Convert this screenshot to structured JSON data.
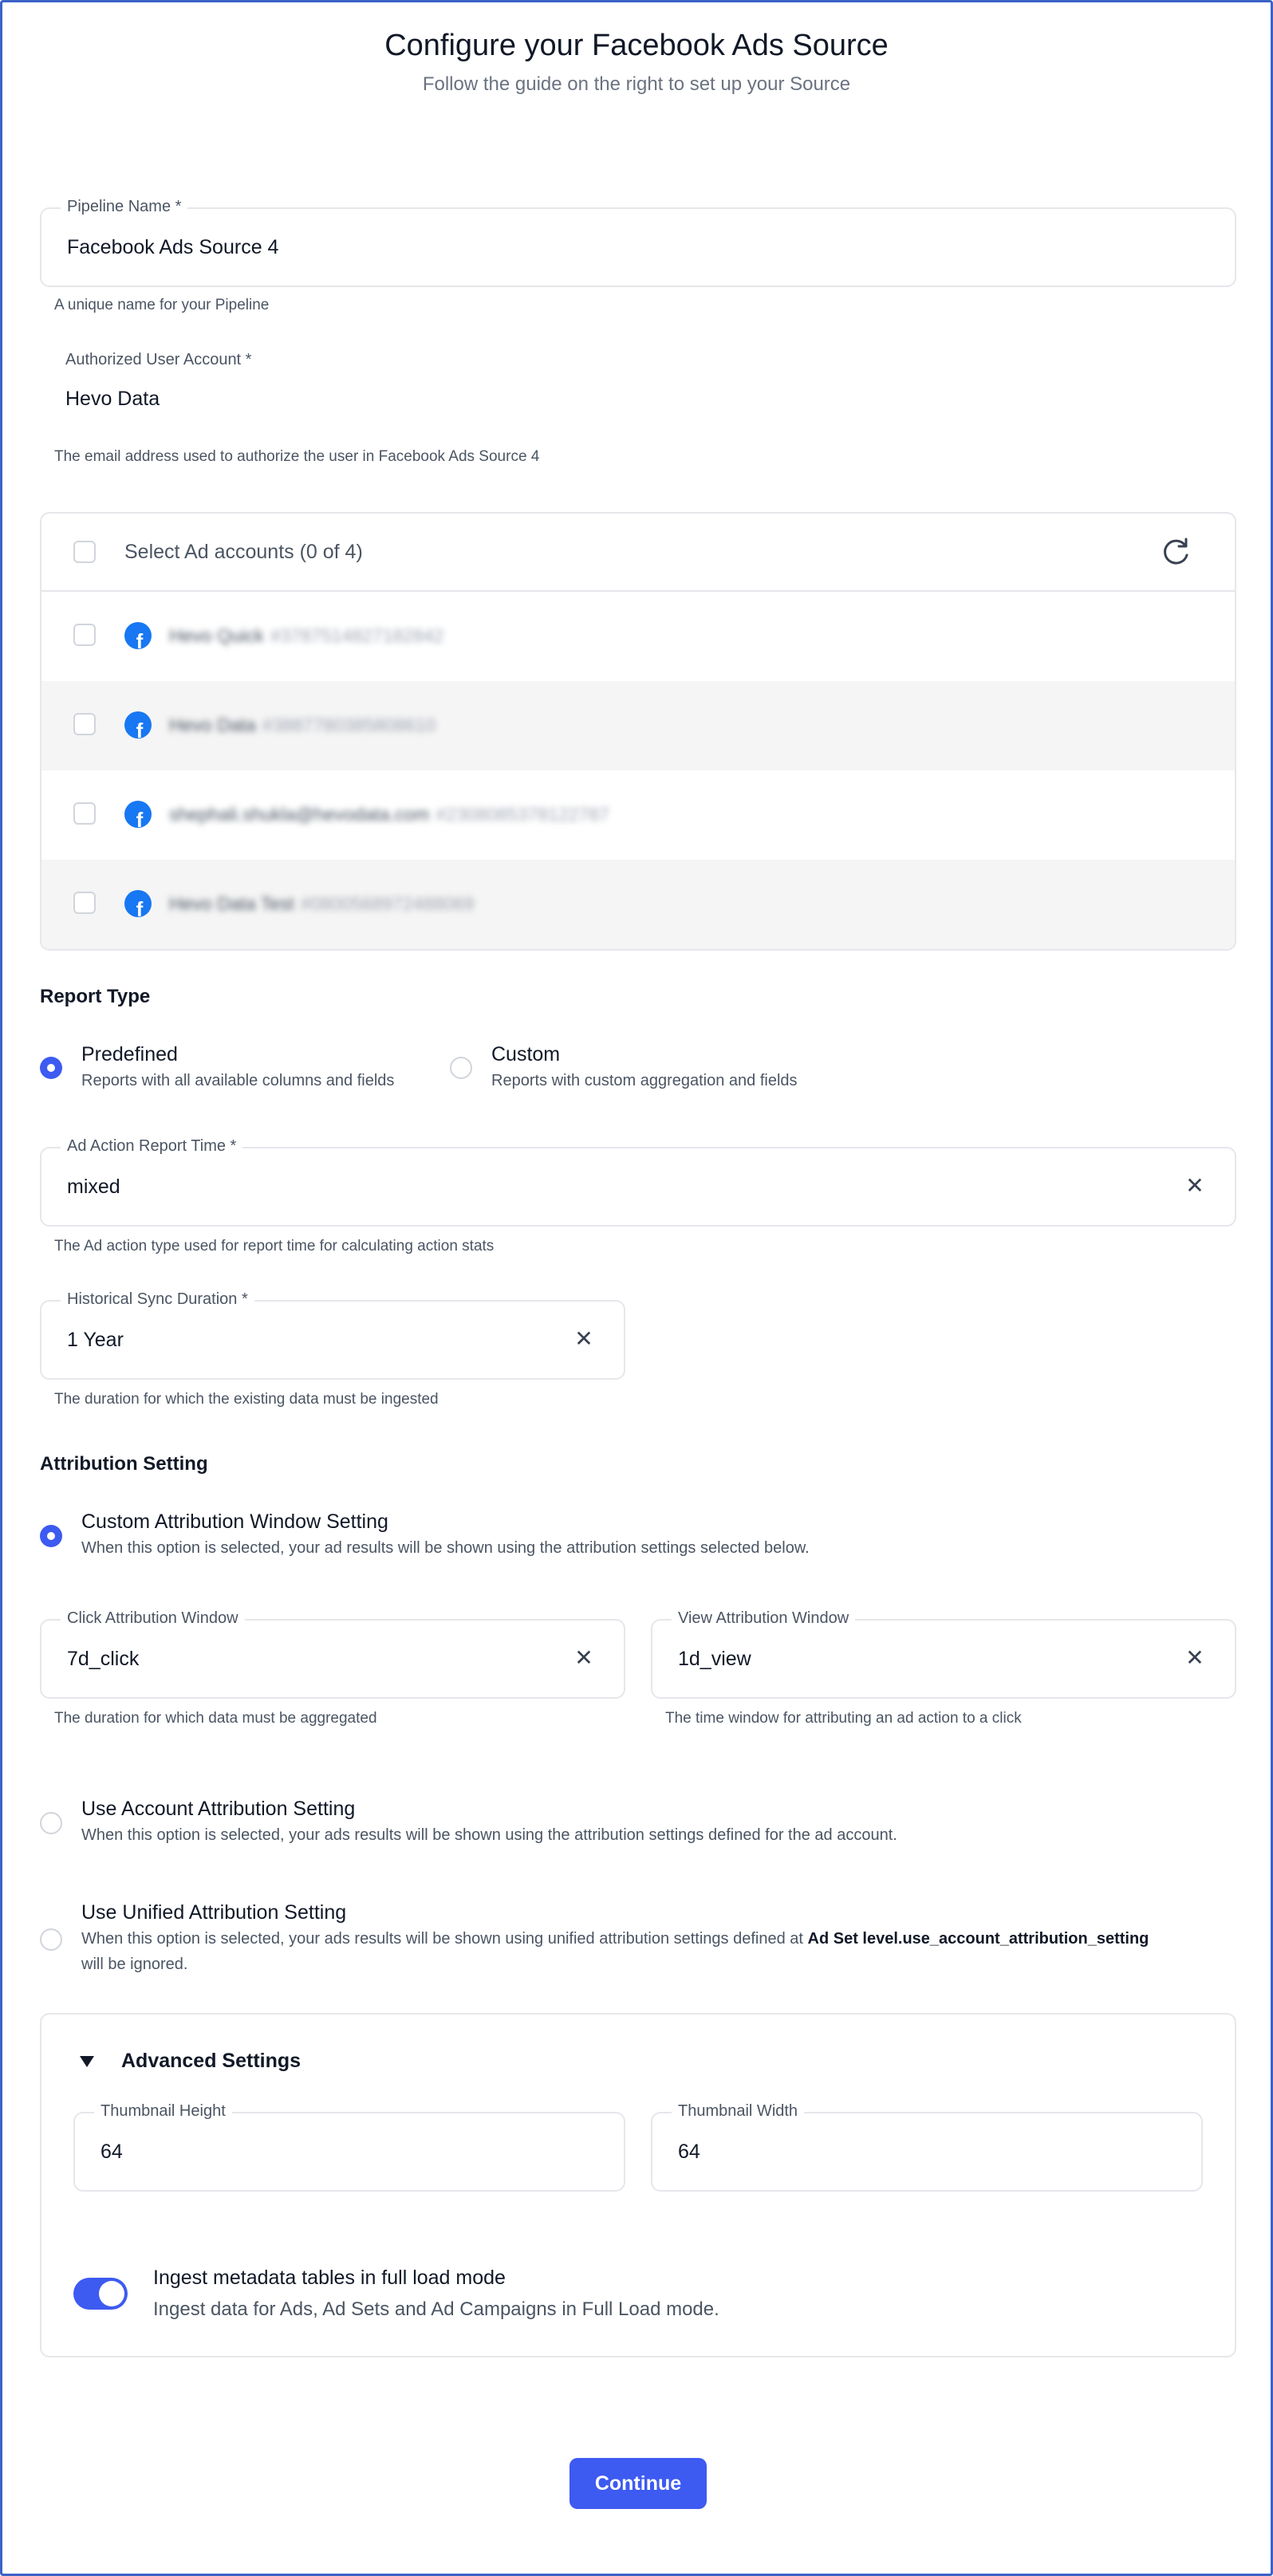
{
  "header": {
    "title": "Configure your Facebook Ads Source",
    "subtitle": "Follow the guide on the right to set up your Source"
  },
  "pipeline_name": {
    "label": "Pipeline Name *",
    "value": "Facebook Ads Source 4",
    "help": "A unique name for your Pipeline"
  },
  "authorized_account": {
    "label": "Authorized User Account *",
    "value": "Hevo Data",
    "help": "The email address used to authorize the user in Facebook Ads Source 4"
  },
  "ad_accounts": {
    "header_label": "Select Ad accounts (0 of 4)",
    "items": [
      {
        "name": "Hevo Quick",
        "id": "#3787514827182842"
      },
      {
        "name": "Hevo Data",
        "id": "#3887780385808610"
      },
      {
        "name": "shephali.shukla@hevodata.com",
        "id": "#2308085378122787"
      },
      {
        "name": "Hevo Data Test",
        "id": "#0800568972488069"
      }
    ]
  },
  "report_type": {
    "heading": "Report Type",
    "options": [
      {
        "title": "Predefined",
        "desc": "Reports with all available columns and fields",
        "selected": true
      },
      {
        "title": "Custom",
        "desc": "Reports with custom aggregation and fields",
        "selected": false
      }
    ]
  },
  "ad_action_report_time": {
    "label": "Ad Action Report Time *",
    "value": "mixed",
    "help": "The Ad action type used for report time for calculating action stats"
  },
  "historical_sync": {
    "label": "Historical Sync Duration *",
    "value": "1 Year",
    "help": "The duration for which the existing data must be ingested"
  },
  "attribution": {
    "heading": "Attribution Setting",
    "custom": {
      "title": "Custom Attribution Window Setting",
      "desc": "When this option is selected, your ad results will be shown using the attribution settings selected below.",
      "selected": true
    },
    "click_window": {
      "label": "Click Attribution Window",
      "value": "7d_click",
      "help": "The duration for which data must be aggregated"
    },
    "view_window": {
      "label": "View Attribution Window",
      "value": "1d_view",
      "help": "The time window for attributing an ad action to a click"
    },
    "account": {
      "title": "Use Account Attribution Setting",
      "desc": "When this option is selected, your ads results will be shown using the attribution settings defined for the ad account.",
      "selected": false
    },
    "unified": {
      "title": "Use Unified Attribution Setting",
      "desc_prefix": "When this option is selected, your ads results will be shown using unified attribution settings defined at ",
      "desc_bold": "Ad Set level.use_account_attribution_setting",
      "desc_suffix": "will be ignored.",
      "selected": false
    }
  },
  "advanced": {
    "title": "Advanced Settings",
    "thumb_height": {
      "label": "Thumbnail Height",
      "value": "64"
    },
    "thumb_width": {
      "label": "Thumbnail Width",
      "value": "64"
    },
    "ingest_toggle": {
      "title": "Ingest metadata tables in full load mode",
      "desc": "Ingest data for Ads, Ad Sets and Ad Campaigns in Full Load mode.",
      "on": true
    }
  },
  "actions": {
    "continue_label": "Continue"
  },
  "colors": {
    "accent": "#3d5af1",
    "facebook": "#1877f2",
    "frame": "#3b62c9"
  },
  "icons": {
    "refresh": "refresh-icon",
    "clear": "close-icon",
    "facebook": "facebook-icon",
    "caret": "caret-down-icon"
  }
}
